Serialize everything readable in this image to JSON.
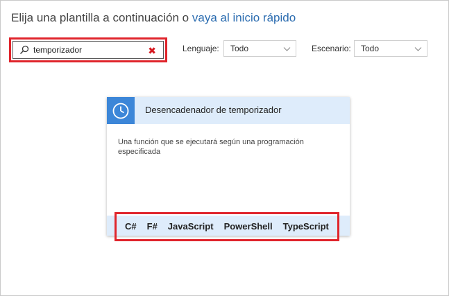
{
  "heading": {
    "text": "Elija una plantilla a continuación o",
    "link": "vaya al inicio rápido"
  },
  "search": {
    "value": "temporizador",
    "clear_icon": "close-x-icon"
  },
  "filters": {
    "language_label": "Lenguaje:",
    "language_value": "Todo",
    "scenario_label": "Escenario:",
    "scenario_value": "Todo"
  },
  "card": {
    "icon": "clock-icon",
    "title": "Desencadenador de temporizador",
    "description": "Una función que se ejecutará según una programación especificada",
    "languages": [
      "C#",
      "F#",
      "JavaScript",
      "PowerShell",
      "TypeScript"
    ]
  },
  "colors": {
    "accent": "#3c86d8",
    "highlight": "#e0242b",
    "link": "#2b6cb0",
    "card_band": "#deecfb"
  }
}
